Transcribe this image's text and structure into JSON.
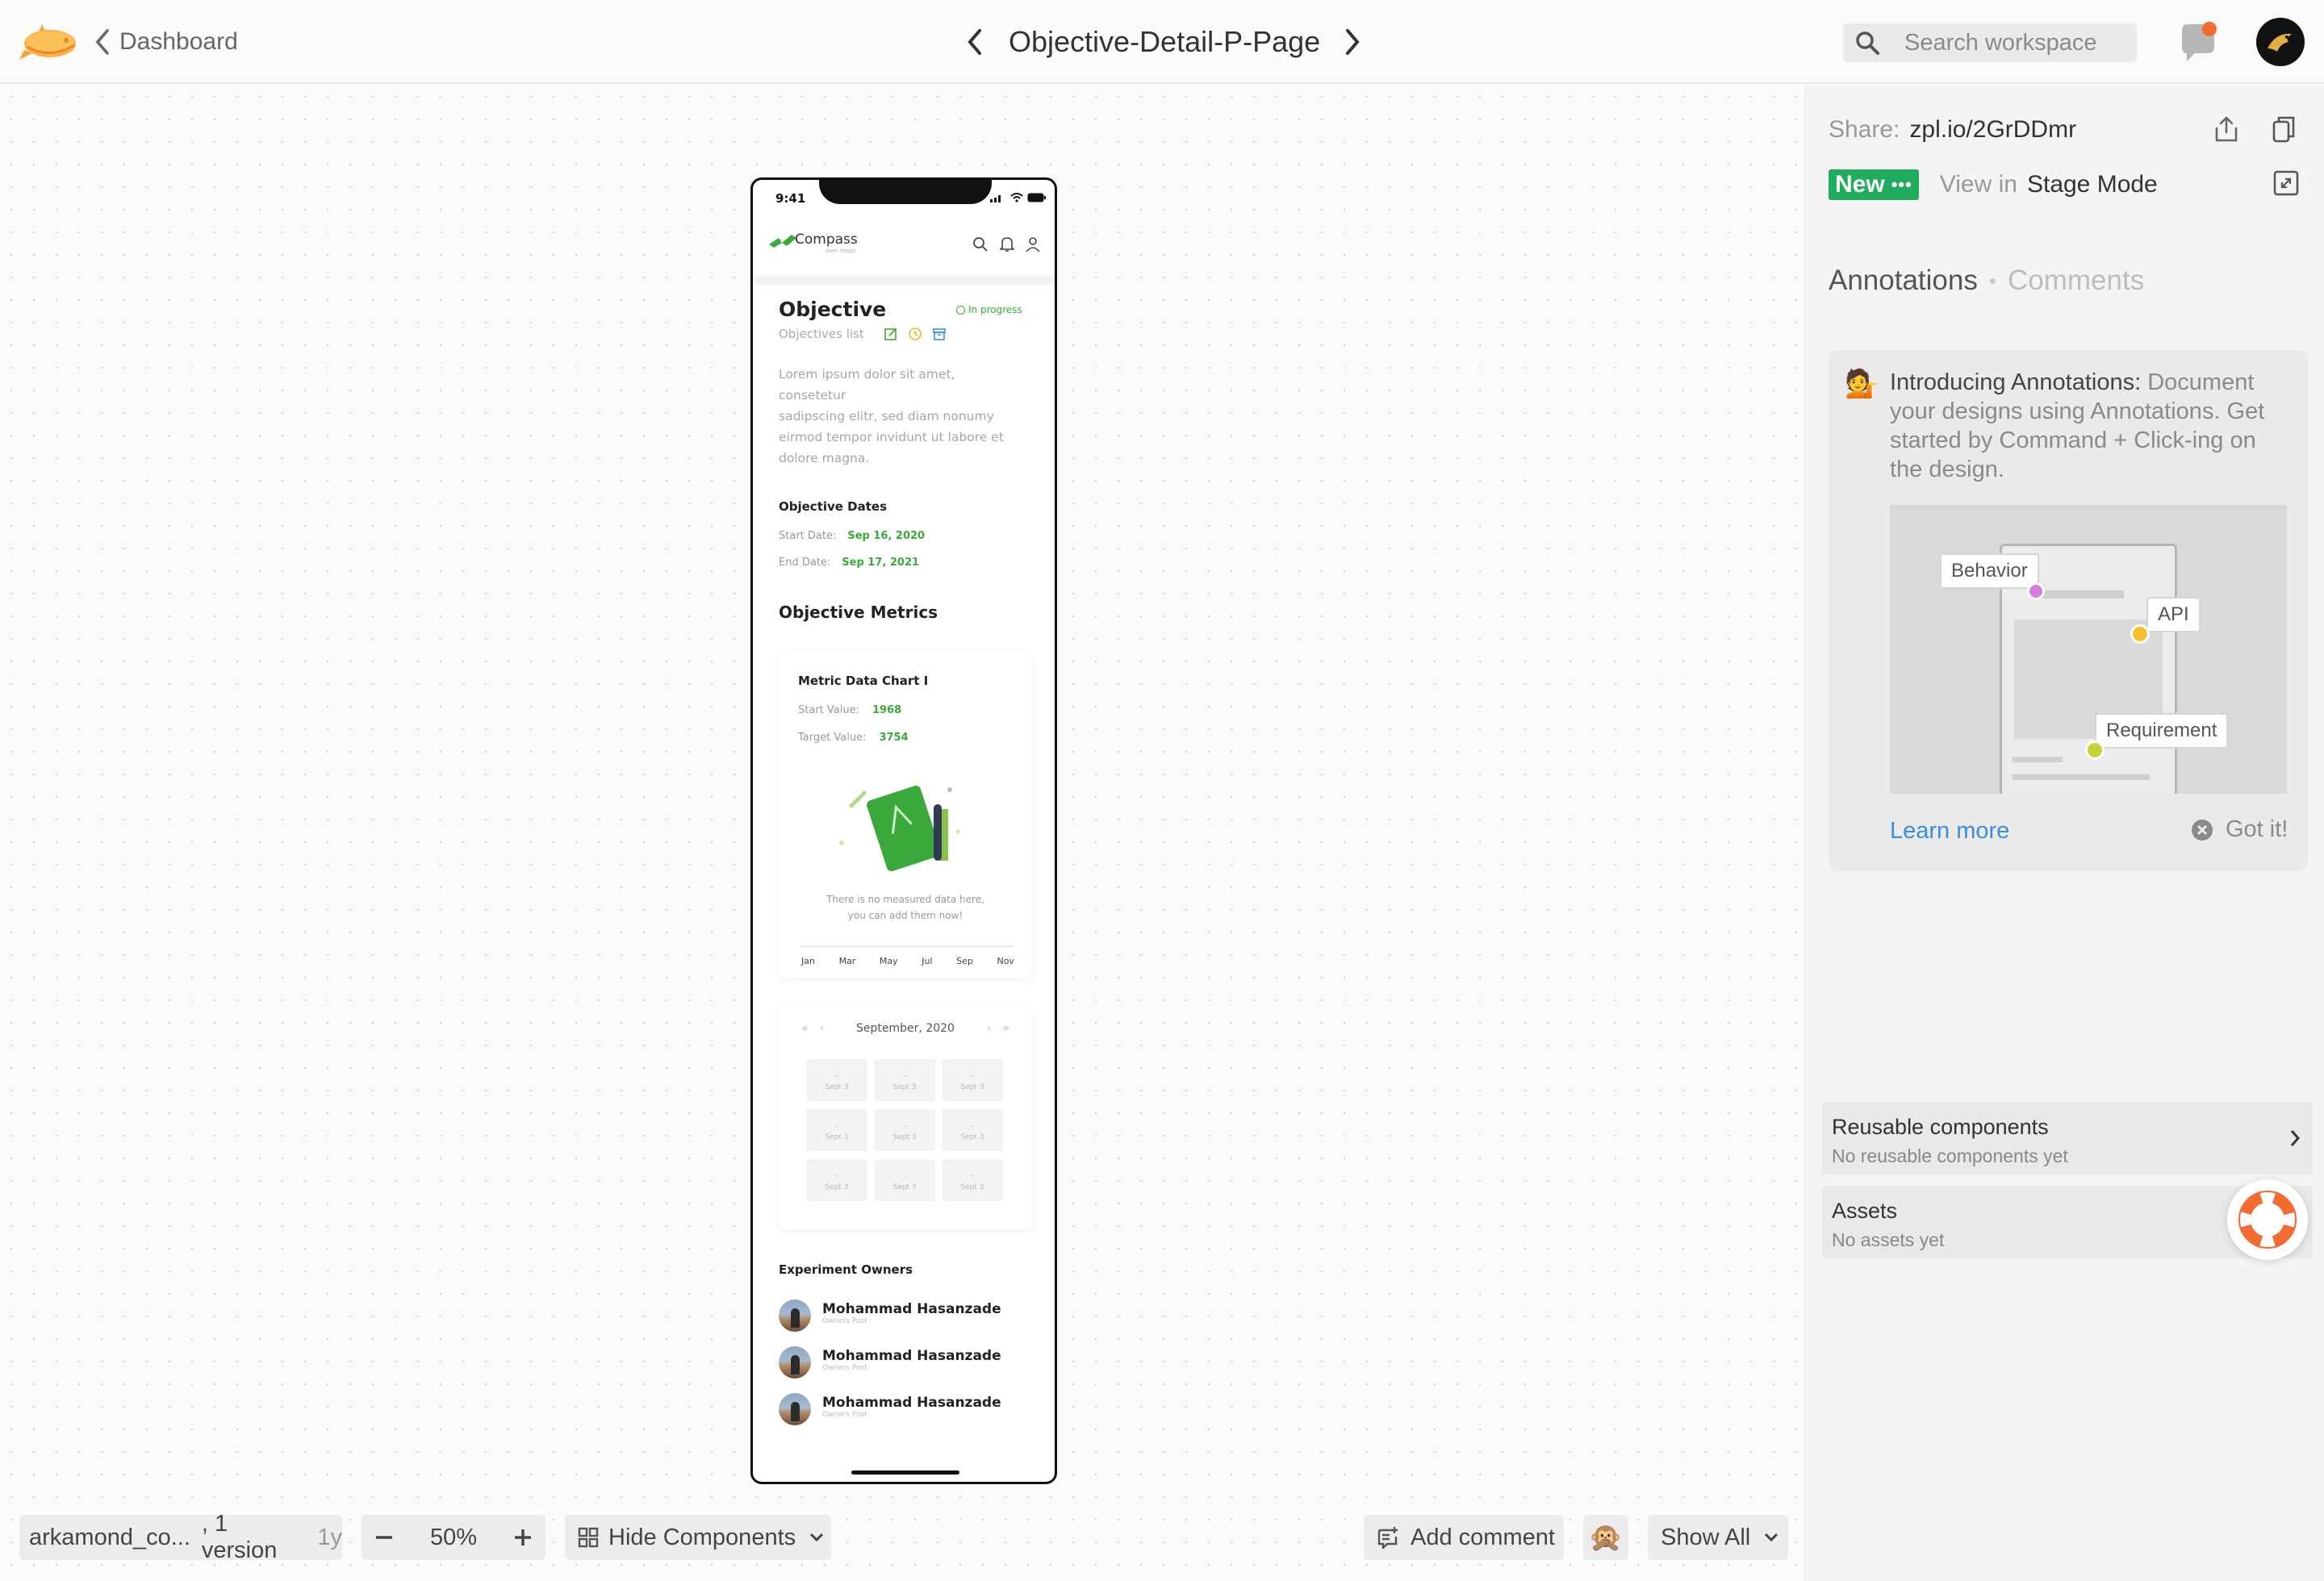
{
  "topbar": {
    "back_label": "Dashboard",
    "screen_title": "Objective-Detail-P-Page",
    "search_placeholder": "Search workspace"
  },
  "sidebar": {
    "share_label": "Share:",
    "share_link": "zpl.io/2GrDDmr",
    "new_badge": "New",
    "view_in": "View in",
    "stage_mode": "Stage Mode",
    "tab_annotations": "Annotations",
    "tab_separator": "•",
    "tab_comments": "Comments",
    "intro": {
      "emoji": "💁",
      "title": "Introducing Annotations:",
      "body": "Document your designs using Annotations. Get started by Command + Click-ing on the design.",
      "tags": {
        "behavior": "Behavior",
        "api": "API",
        "requirement": "Requirement"
      },
      "learn_more": "Learn more",
      "got_it": "Got it!"
    },
    "reusable": {
      "title": "Reusable components",
      "subtitle": "No reusable components yet"
    },
    "assets": {
      "title": "Assets",
      "subtitle": "No assets yet"
    }
  },
  "bottombar": {
    "project_name": "arkamond_co...",
    "versions": ", 1 version",
    "age": "1y",
    "zoom": "50%",
    "hide_components": "Hide Components",
    "add_comment": "Add comment",
    "user_emoji": "🙊",
    "show_all": "Show All"
  },
  "phone": {
    "time": "9:41",
    "brand": "Compass",
    "brand_sub": "over maps",
    "title": "Objective",
    "status": "In progress",
    "breadcrumb": "Objectives list",
    "description": [
      "Lorem ipsum dolor sit amet,",
      "consetetur",
      "sadipscing elitr, sed diam nonumy",
      "eirmod tempor invidunt ut labore et",
      "dolore magna."
    ],
    "dates_title": "Objective Dates",
    "start_label": "Start Date:",
    "start_value": "Sep 16, 2020",
    "end_label": "End Date:",
    "end_value": "Sep 17, 2021",
    "metrics_title": "Objective Metrics",
    "metric_card": {
      "title": "Metric Data Chart I",
      "start_label": "Start Value:",
      "start_value": "1968",
      "target_label": "Target Value:",
      "target_value": "3754",
      "empty_line1": "There is no measured data here,",
      "empty_line2": "you can add them now!",
      "months": [
        "Jan",
        "Mar",
        "May",
        "Jul",
        "Sep",
        "Nov"
      ]
    },
    "calendar": {
      "month": "September, 2020",
      "cells": [
        {
          "dash": "–",
          "label": "Sept 3"
        },
        {
          "dash": "–",
          "label": "Sept 3"
        },
        {
          "dash": "–",
          "label": "Sept 3"
        },
        {
          "dash": "–",
          "label": "Sept 3"
        },
        {
          "dash": "–",
          "label": "Sept 3"
        },
        {
          "dash": "–",
          "label": "Sept 3"
        },
        {
          "dash": "–",
          "label": "Sept 3"
        },
        {
          "dash": "–",
          "label": "Sept 3"
        },
        {
          "dash": "–",
          "label": "Sept 3"
        }
      ]
    },
    "owners_title": "Experiment Owners",
    "owners": [
      {
        "name": "Mohammad Hasanzade",
        "post": "Owners Post"
      },
      {
        "name": "Mohammad Hasanzade",
        "post": "Owners Post"
      },
      {
        "name": "Mohammad Hasanzade",
        "post": "Owners Post"
      }
    ]
  },
  "colors": {
    "accent_green": "#3ba83b",
    "new_badge": "#1fad5d",
    "link_blue": "#3b8fd9",
    "behavior_dot": "#d57ee0",
    "api_dot": "#f2c12e",
    "requirement_dot": "#c7d236",
    "lifebuoy": "#f26b30"
  },
  "icons": [
    "zeplin-logo-icon",
    "chevron-left-icon",
    "chevron-right-icon",
    "search-icon",
    "notification-bell-icon",
    "avatar",
    "share-upload-icon",
    "copy-icon",
    "expand-icon",
    "close-circle-icon",
    "chevron-down-icon",
    "components-grid-icon",
    "comment-add-icon",
    "lifebuoy-icon"
  ]
}
